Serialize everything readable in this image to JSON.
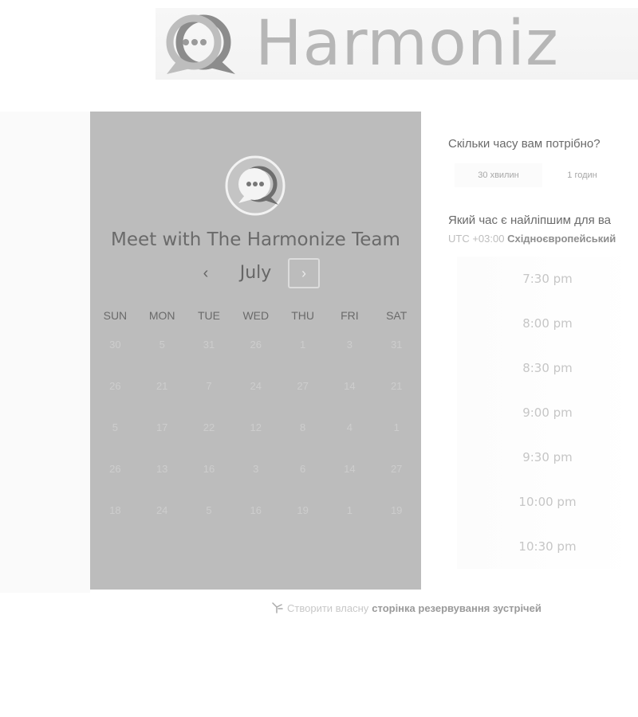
{
  "brand": {
    "name": "Harmoniz"
  },
  "calendar": {
    "title": "Meet with The Harmonize Team",
    "month": "July",
    "prev_symbol": "‹",
    "next_symbol": "›",
    "weekdays": [
      "SUN",
      "MON",
      "TUE",
      "WED",
      "THU",
      "FRI",
      "SAT"
    ],
    "weeks": [
      [
        "30",
        "5",
        "31",
        "26",
        "1",
        "3",
        "31"
      ],
      [
        "26",
        "21",
        "7",
        "24",
        "27",
        "14",
        "21"
      ],
      [
        "5",
        "17",
        "22",
        "12",
        "8",
        "4",
        "1"
      ],
      [
        "26",
        "13",
        "16",
        "3",
        "6",
        "14",
        "27"
      ],
      [
        "18",
        "24",
        "5",
        "16",
        "19",
        "1",
        "19"
      ]
    ]
  },
  "duration": {
    "question": "Скільки часу вам потрібно?",
    "options": [
      "30 хвилин",
      "1 годин"
    ]
  },
  "time": {
    "question": "Який час є найліпшим для ва",
    "tz_offset": "UTC +03:00",
    "tz_name": "Східноєвропейський",
    "slots": [
      "7:30 pm",
      "8:00 pm",
      "8:30 pm",
      "9:00 pm",
      "9:30 pm",
      "10:00 pm",
      "10:30 pm"
    ]
  },
  "footer": {
    "plain": "Створити власну",
    "link": "сторінка резервування зустрічей"
  },
  "colors": {
    "card_bg": "#bcbcbc",
    "accent": "#888888"
  }
}
